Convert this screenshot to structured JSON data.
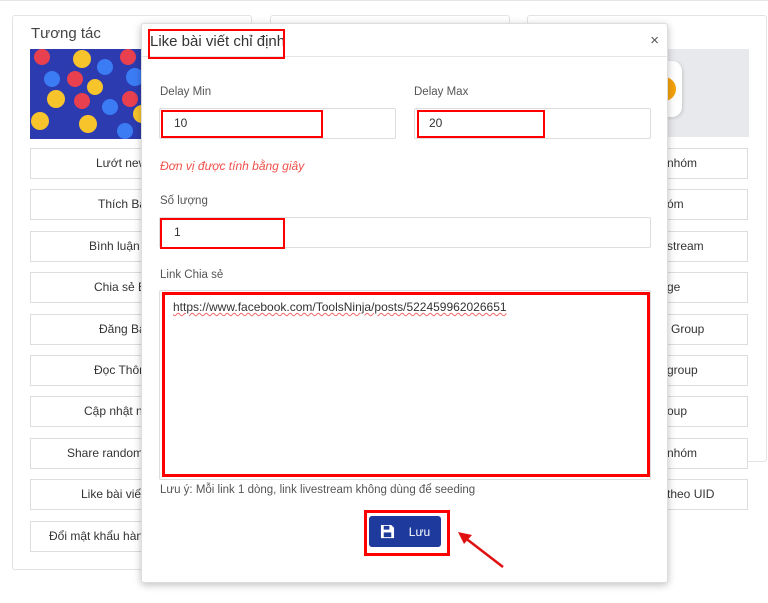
{
  "left_card": {
    "title": "Tương tác",
    "buttons": [
      "Lướt new",
      "Thích Bà",
      "Bình luận B",
      "Chia sẻ B",
      "Đăng Bà",
      "Đọc Thôn",
      "Cập nhật ng",
      "Share random",
      "Like bài viết",
      "Đổi mật khẩu hàng"
    ]
  },
  "right_card": {
    "buttons": [
      "nhóm",
      "óm",
      "stream",
      "ge",
      "Group",
      "group",
      "oup",
      "nhóm",
      "theo UID"
    ]
  },
  "modal": {
    "title": "Like bài viết chỉ định",
    "close_icon": "×",
    "delay_min_label": "Delay Min",
    "delay_min_value": "10",
    "delay_max_label": "Delay Max",
    "delay_max_value": "20",
    "unit_hint": "Đơn vị được tính bằng giây",
    "quantity_label": "Số lượng",
    "quantity_value": "1",
    "link_label": "Link Chia sẻ",
    "link_value": "https://www.facebook.com/ToolsNinja/posts/522459962026651",
    "note": "Lưu ý: Mỗi link 1 dòng, link livestream không dùng để seeding",
    "save_label": "Lưu",
    "save_icon": "floppy-disk-icon"
  },
  "colors": {
    "highlight": "#ff0000",
    "primary": "#1d3a9c",
    "hint": "#f0504a"
  }
}
